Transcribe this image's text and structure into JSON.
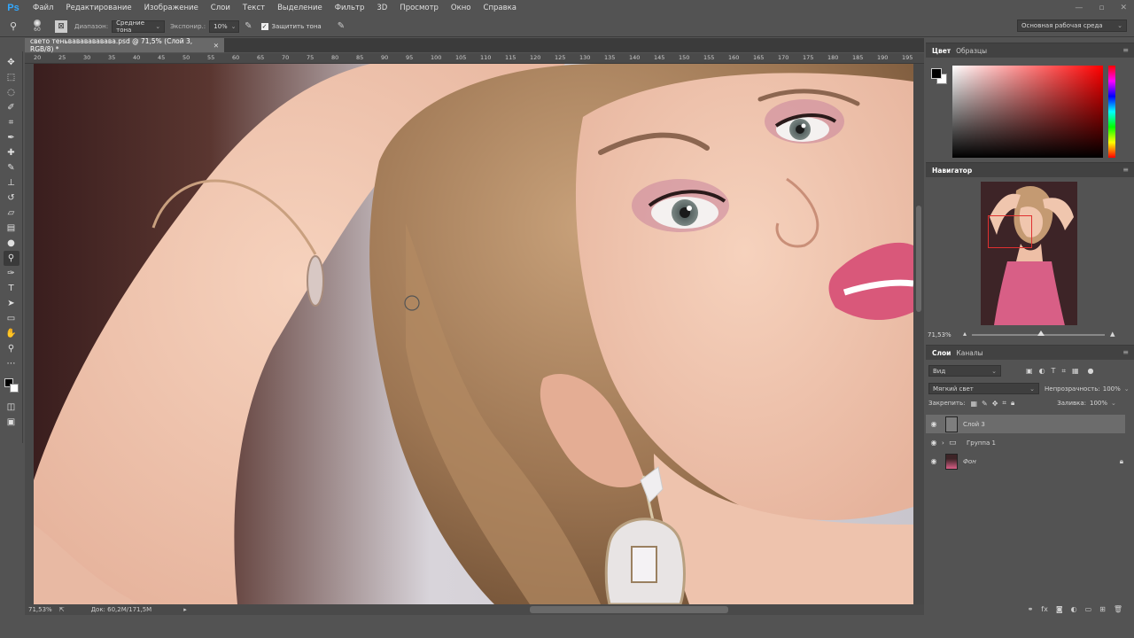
{
  "app": {
    "logo": "Ps"
  },
  "menu": [
    "Файл",
    "Редактирование",
    "Изображение",
    "Слои",
    "Текст",
    "Выделение",
    "Фильтр",
    "3D",
    "Просмотр",
    "Окно",
    "Справка"
  ],
  "options": {
    "brush_size": "60",
    "range_label": "Диапазон:",
    "range_value": "Средние тона",
    "exposure_label": "Экспонир.:",
    "exposure_value": "10%",
    "protect_tones": "Защитить тона",
    "workspace": "Основная рабочая среда"
  },
  "document": {
    "tab_title": "свето теньвававававава.psd @ 71,5% (Слой 3, RGB/8) *",
    "ruler_top": [
      "20",
      "25",
      "30",
      "35",
      "40",
      "45",
      "50",
      "55",
      "60",
      "65",
      "70",
      "75",
      "80",
      "85",
      "90",
      "95",
      "100",
      "105",
      "110",
      "115",
      "120",
      "125",
      "130",
      "135",
      "140",
      "145",
      "150",
      "155",
      "160",
      "165",
      "170",
      "175",
      "180",
      "185",
      "190",
      "195"
    ]
  },
  "status": {
    "zoom": "71,53%",
    "doc_size": "Док: 60,2M/171,5M"
  },
  "panels": {
    "color": {
      "tab_active": "Цвет",
      "tab_other": "Образцы"
    },
    "navigator": {
      "title": "Навигатор",
      "zoom": "71,53%"
    },
    "layers": {
      "tab_active": "Слои",
      "tab_other": "Каналы",
      "filter": "Вид",
      "blend_mode": "Мягкий свет",
      "opacity_label": "Непрозрачность:",
      "opacity_value": "100%",
      "lock_label": "Закрепить:",
      "fill_label": "Заливка:",
      "fill_value": "100%",
      "items": [
        {
          "name": "Слой 3",
          "selected": true
        },
        {
          "name": "Группа 1",
          "selected": false
        },
        {
          "name": "Фон",
          "selected": false
        }
      ]
    }
  }
}
